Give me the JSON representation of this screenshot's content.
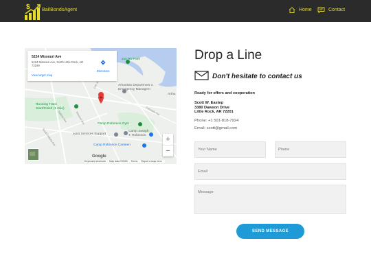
{
  "header": {
    "brand": "BailBondsAgent",
    "nav": [
      {
        "label": "Home",
        "icon": "home-icon"
      },
      {
        "label": "Contact",
        "icon": "chat-icon"
      }
    ],
    "accent_color": "#e6dc2e",
    "background_color": "#2b2b2b"
  },
  "map": {
    "place_title": "5224 Missouri Ave",
    "place_address": "5224 Missouri Ave, North Little Rock, AR 72199",
    "view_larger_label": "View larger map",
    "directions_label": "Directions",
    "zoom_in": "+",
    "zoom_out": "−",
    "google_label": "Google",
    "footer": [
      "Keyboard shortcuts",
      "Map data ©2023",
      "Terms",
      "Report a map error"
    ],
    "pois": {
      "rv_park": "son RV Park",
      "arkansas_dept": "Arkansas Department o\nEmergency Managem",
      "arthur": "Arthu",
      "running_track": "Running Track\nStart/Finish (1 mile)",
      "gym": "Camp Robinson Gym",
      "joint_services": "Joint Services Support",
      "camp_joseph": "Camp Joseph\nT. Robinson",
      "canteen": "Camp Robinson Canteen"
    },
    "streets": [
      "13th St",
      "Missouri Ave",
      "Colorado Ave",
      "South Dakota Ave",
      "Dakota Ave"
    ]
  },
  "contact": {
    "heading": "Drop a Line",
    "tagline": "Don't hesitate to contact us",
    "offers": "Ready for offers and cooperation",
    "name": "Scott W. Eastep",
    "street": "3380 Dawson Drive",
    "city": "Little Rock, AR 72201",
    "phone": "Phone: +1 501-818-7924",
    "email": "Email: scott@gmail.com"
  },
  "form": {
    "name_placeholder": "Your Name",
    "phone_placeholder": "Phone",
    "email_placeholder": "Email",
    "message_placeholder": "Message",
    "submit_label": "SEND MESSAGE",
    "button_color": "#1e9ad6"
  }
}
